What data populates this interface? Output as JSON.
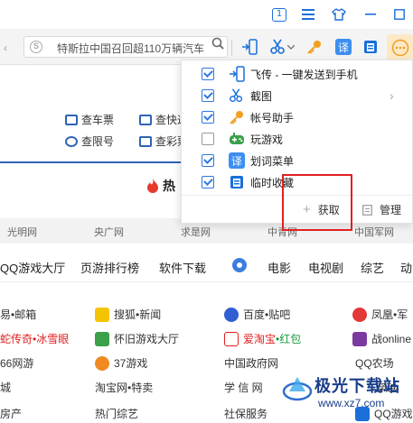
{
  "titlebar": {
    "tab_count": "1"
  },
  "toolbar": {
    "address_text": "特斯拉中国召回超110万辆汽车",
    "colors": {
      "accent": "#1a6fd8",
      "more_bg": "#fde8c6"
    }
  },
  "page": {
    "quick_links": [
      "查车票",
      "查快递",
      "查限号",
      "查彩票"
    ],
    "hot_label": "热",
    "news_sites": [
      "光明网",
      "央广网",
      "求是网",
      "中青网",
      "中国军网"
    ],
    "nav": [
      "QQ游戏大厅",
      "页游排行榜",
      "软件下载",
      "电影",
      "电视剧",
      "综艺",
      "动"
    ],
    "links": [
      {
        "text": "易•邮箱"
      },
      {
        "text": "搜狐•新闻"
      },
      {
        "text": "百度•贴吧"
      },
      {
        "text": "凤凰•军"
      },
      {
        "text": "蛇传奇•冰雪眼",
        "color": "red"
      },
      {
        "text": "怀旧游戏大厅"
      },
      {
        "text_a": "爱淘宝",
        "text_b": "•红包"
      },
      {
        "text": "战online"
      },
      {
        "text": "66网游"
      },
      {
        "text": "37游戏"
      },
      {
        "text": "中国政府网"
      },
      {
        "text": "QQ农场"
      },
      {
        "text": "城"
      },
      {
        "text": "淘宝网•特卖"
      },
      {
        "text": "学 信 网"
      },
      {
        "text": "穿越"
      },
      {
        "text": "房产"
      },
      {
        "text": "热门综艺"
      },
      {
        "text": "社保服务"
      },
      {
        "text": "QQ游戏"
      }
    ]
  },
  "menu": {
    "items": [
      {
        "label": "飞传 - 一键发送到手机",
        "checked": true,
        "icon": "send-to-phone-icon"
      },
      {
        "label": "截图",
        "checked": true,
        "icon": "scissors-icon"
      },
      {
        "label": "帐号助手",
        "checked": true,
        "icon": "key-icon"
      },
      {
        "label": "玩游戏",
        "checked": false,
        "icon": "gamepad-icon"
      },
      {
        "label": "划词菜单",
        "checked": true,
        "icon": "translate-icon"
      },
      {
        "label": "临时收藏",
        "checked": true,
        "icon": "bookmark-icon"
      }
    ],
    "get_label": "获取",
    "manage_label": "管理"
  },
  "watermark": {
    "title": "极光下载站",
    "url": "www.xz7.com"
  }
}
